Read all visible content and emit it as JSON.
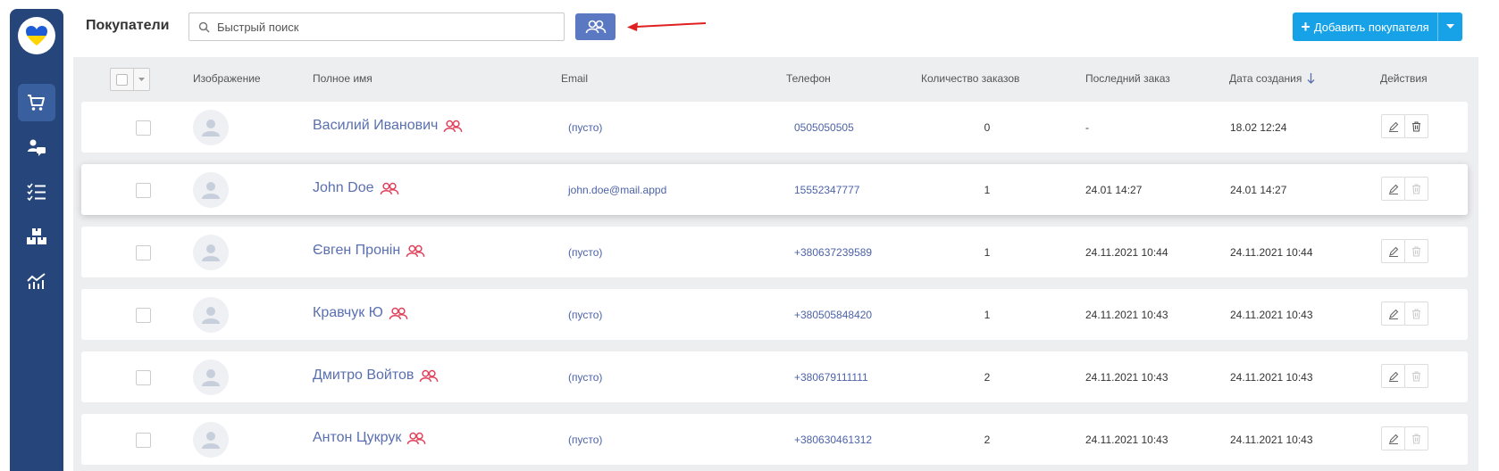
{
  "header": {
    "title": "Покупатели",
    "search_placeholder": "Быстрый поиск",
    "add_button_label": "Добавить покупателя"
  },
  "colors": {
    "sidebar": "#26457a",
    "primary": "#17a2e8",
    "group_button": "#5b78c2",
    "arrow": "#e02020",
    "customer_icon": "#e0405a"
  },
  "sidebar": {
    "items": [
      {
        "icon": "shopping-cart-icon",
        "active": true
      },
      {
        "icon": "customers-chat-icon",
        "active": false
      },
      {
        "icon": "checklist-icon",
        "active": false
      },
      {
        "icon": "boxes-icon",
        "active": false
      },
      {
        "icon": "analytics-chart-icon",
        "active": false
      }
    ]
  },
  "table": {
    "columns": {
      "image": "Изображение",
      "full_name": "Полное имя",
      "email": "Email",
      "phone": "Телефон",
      "orders_count": "Количество заказов",
      "last_order": "Последний заказ",
      "created": "Дата создания",
      "actions": "Действия"
    },
    "rows": [
      {
        "name": "Василий Иванович",
        "email": "(пусто)",
        "phone": "0505050505",
        "orders": "0",
        "last_order": "-",
        "created": "18.02 12:24"
      },
      {
        "name": "John Doe",
        "email": "john.doe@mail.appd",
        "phone": "15552347777",
        "orders": "1",
        "last_order": "24.01 14:27",
        "created": "24.01 14:27"
      },
      {
        "name": "Євген Пронін",
        "email": "(пусто)",
        "phone": "+380637239589",
        "orders": "1",
        "last_order": "24.11.2021 10:44",
        "created": "24.11.2021 10:44"
      },
      {
        "name": "Кравчук Ю",
        "email": "(пусто)",
        "phone": "+380505848420",
        "orders": "1",
        "last_order": "24.11.2021 10:43",
        "created": "24.11.2021 10:43"
      },
      {
        "name": "Дмитро Войтов",
        "email": "(пусто)",
        "phone": "+380679111111",
        "orders": "2",
        "last_order": "24.11.2021 10:43",
        "created": "24.11.2021 10:43"
      },
      {
        "name": "Антон Цукрук",
        "email": "(пусто)",
        "phone": "+380630461312",
        "orders": "2",
        "last_order": "24.11.2021 10:43",
        "created": "24.11.2021 10:43"
      }
    ]
  }
}
